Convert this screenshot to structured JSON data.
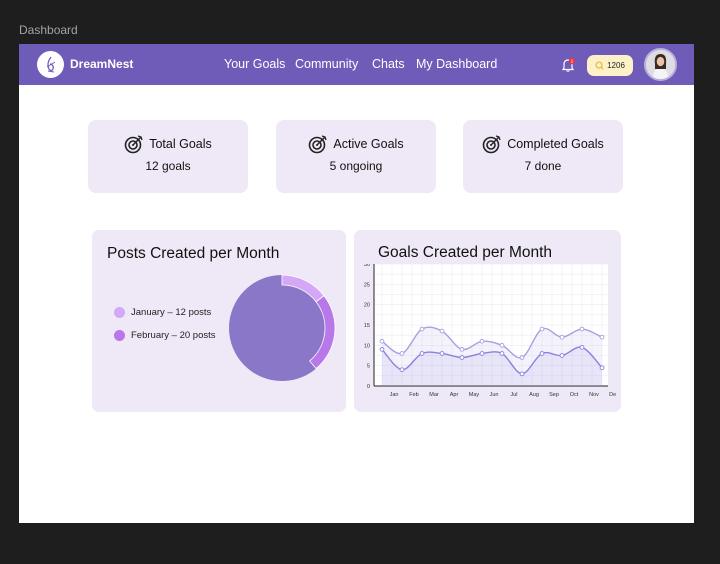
{
  "frame_label": "Dashboard",
  "nav": {
    "brand": "DreamNest",
    "links": [
      "Your Goals",
      "Community",
      "Chats",
      "My Dashboard"
    ],
    "coins": "1206",
    "notification_count": "1"
  },
  "stats": [
    {
      "title": "Total Goals",
      "value": "12 goals"
    },
    {
      "title": "Active Goals",
      "value": "5 ongoing"
    },
    {
      "title": "Completed Goals",
      "value": "7 done"
    }
  ],
  "colors": {
    "nav": "#6f5bb8",
    "card": "#efe8f6",
    "pie_jan": "#d4a8f6",
    "pie_feb": "#b878ea",
    "pie_base": "#8b77c8",
    "line_upper": "#a89fe0",
    "line_lower": "#8a82dc"
  },
  "chart_data": [
    {
      "type": "pie",
      "title": "Posts Created per Month",
      "slices": [
        {
          "label": "January – 12 posts",
          "value": 12
        },
        {
          "label": "February – 20 posts",
          "value": 20
        }
      ]
    },
    {
      "type": "line",
      "title": "Goals Created per Month",
      "categories": [
        "Jan",
        "Feb",
        "Mar",
        "Apr",
        "May",
        "Jun",
        "Jul",
        "Aug",
        "Sep",
        "Oct",
        "Nov",
        "Dec"
      ],
      "ylim": [
        0,
        30
      ],
      "yticks": [
        "0",
        "5",
        "10",
        "15",
        "20",
        "25",
        "30"
      ],
      "grid": true,
      "series": [
        {
          "values": [
            11,
            8,
            14,
            13.5,
            9,
            11,
            10,
            7,
            14,
            12,
            14,
            12
          ]
        },
        {
          "values": [
            9,
            4,
            8,
            8,
            7,
            8,
            8,
            3,
            8,
            7.5,
            9.5,
            4.5
          ]
        }
      ]
    }
  ]
}
